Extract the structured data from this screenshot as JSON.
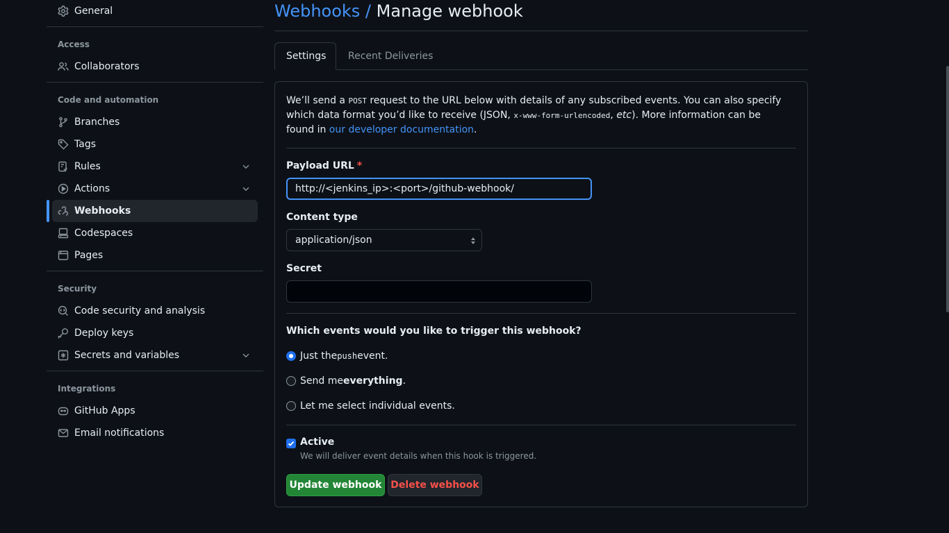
{
  "sidebar": {
    "general": {
      "label": "General",
      "icon": "gear-icon"
    },
    "sections": {
      "access": "Access",
      "code_automation": "Code and automation",
      "security": "Security",
      "integrations": "Integrations"
    },
    "items": {
      "collaborators": "Collaborators",
      "branches": "Branches",
      "tags": "Tags",
      "rules": "Rules",
      "actions": "Actions",
      "webhooks": "Webhooks",
      "codespaces": "Codespaces",
      "pages": "Pages",
      "code_security": "Code security and analysis",
      "deploy_keys": "Deploy keys",
      "secrets": "Secrets and variables",
      "github_apps": "GitHub Apps",
      "email_notifications": "Email notifications"
    },
    "selected": "Webhooks"
  },
  "header": {
    "crumb": "Webhooks /",
    "title": "Manage webhook"
  },
  "tabs": {
    "settings": "Settings",
    "recent": "Recent Deliveries"
  },
  "form": {
    "intro": {
      "p1": "We’ll send a ",
      "post": "POST",
      "p2": " request to the URL below with details of any subscribed events. You can also specify which data format you’d like to receive (JSON, ",
      "urlenc": "x-www-form-urlencoded",
      "p3": ", ",
      "etc": "etc",
      "p4": "). More information can be found in ",
      "link": "our developer documentation",
      "p5": "."
    },
    "payload_label": "Payload URL",
    "required_mark": "*",
    "payload_value": "http://<jenkins_ip>:<port>/github-webhook/",
    "content_type_label": "Content type",
    "content_type_value": "application/json",
    "secret_label": "Secret",
    "secret_value": "",
    "events_question": "Which events would you like to trigger this webhook?",
    "events": {
      "push_pre": "Just the ",
      "push_code": "push",
      "push_post": " event.",
      "everything_pre": "Send me ",
      "everything_bold": "everything",
      "everything_post": ".",
      "individual": "Let me select individual events."
    },
    "selected_event": "push",
    "active_label": "Active",
    "active_checked": true,
    "active_note": "We will deliver event details when this hook is triggered.",
    "update_button": "Update webhook",
    "delete_button": "Delete webhook"
  },
  "colors": {
    "accent": "#4493f8",
    "success": "#238636",
    "danger": "#f85149",
    "background": "#0d1117"
  }
}
